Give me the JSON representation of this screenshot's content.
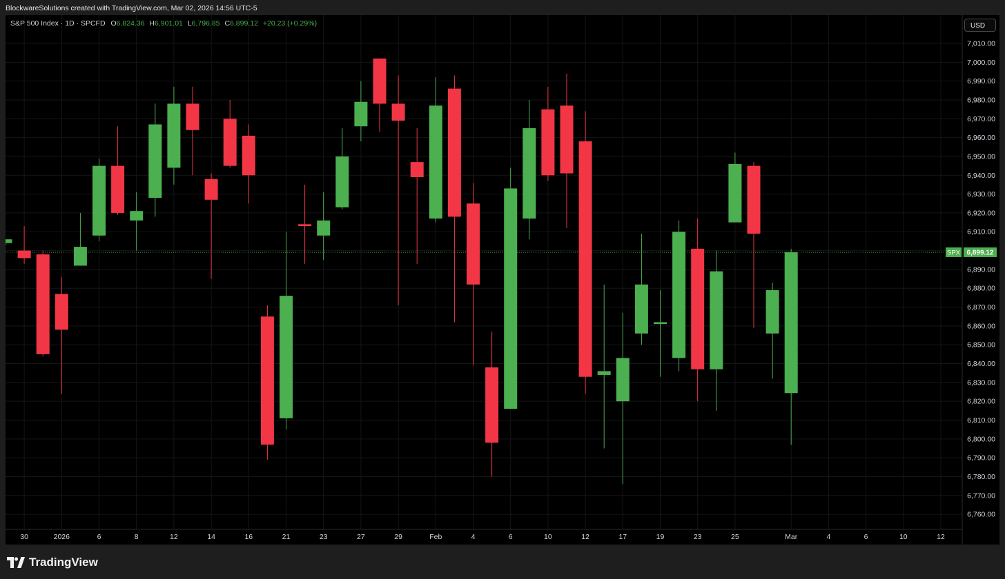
{
  "header": {
    "credit": "BlockwareSolutions created with TradingView.com, Mar 02, 2026 14:56 UTC-5"
  },
  "legend": {
    "symbol": "S&P 500 Index · 1D · SPCFD",
    "o_label": "O",
    "o_value": "6,824.36",
    "h_label": "H",
    "h_value": "6,901.01",
    "l_label": "L",
    "l_value": "6,796.85",
    "c_label": "C",
    "c_value": "6,899.12",
    "change": "+20.23 (+0.29%)"
  },
  "currency_button": "USD",
  "price_tag": {
    "symbol": "SPX",
    "value": "6,899.12"
  },
  "brand": "TradingView",
  "colors": {
    "up": "#4caf50",
    "down": "#f23645",
    "background": "#000000",
    "text": "#d1d4dc",
    "legend_value": "#4caf50"
  },
  "chart_data": {
    "type": "candlestick",
    "interval": "1D",
    "symbol": "SPX",
    "last_price": 6899.12,
    "ylim": [
      6752,
      7025
    ],
    "y_ticks": [
      {
        "v": 6760,
        "label": "6,760.00"
      },
      {
        "v": 6770,
        "label": "6,770.00"
      },
      {
        "v": 6780,
        "label": "6,780.00"
      },
      {
        "v": 6790,
        "label": "6,790.00"
      },
      {
        "v": 6800,
        "label": "6,800.00"
      },
      {
        "v": 6810,
        "label": "6,810.00"
      },
      {
        "v": 6820,
        "label": "6,820.00"
      },
      {
        "v": 6830,
        "label": "6,830.00"
      },
      {
        "v": 6840,
        "label": "6,840.00"
      },
      {
        "v": 6850,
        "label": "6,850.00"
      },
      {
        "v": 6860,
        "label": "6,860.00"
      },
      {
        "v": 6870,
        "label": "6,870.00"
      },
      {
        "v": 6880,
        "label": "6,880.00"
      },
      {
        "v": 6890,
        "label": "6,890.00"
      },
      {
        "v": 6900,
        "label": "6,900.00"
      },
      {
        "v": 6910,
        "label": "6,910.00"
      },
      {
        "v": 6920,
        "label": "6,920.00"
      },
      {
        "v": 6930,
        "label": "6,930.00"
      },
      {
        "v": 6940,
        "label": "6,940.00"
      },
      {
        "v": 6950,
        "label": "6,950.00"
      },
      {
        "v": 6960,
        "label": "6,960.00"
      },
      {
        "v": 6970,
        "label": "6,970.00"
      },
      {
        "v": 6980,
        "label": "6,980.00"
      },
      {
        "v": 6990,
        "label": "6,990.00"
      },
      {
        "v": 7000,
        "label": "7,000.00"
      },
      {
        "v": 7010,
        "label": "7,010.00"
      }
    ],
    "x_ticks": [
      {
        "i": 1,
        "label": "30"
      },
      {
        "i": 3,
        "label": "2026"
      },
      {
        "i": 5,
        "label": "6"
      },
      {
        "i": 7,
        "label": "8"
      },
      {
        "i": 9,
        "label": "12"
      },
      {
        "i": 11,
        "label": "14"
      },
      {
        "i": 13,
        "label": "16"
      },
      {
        "i": 15,
        "label": "21"
      },
      {
        "i": 17,
        "label": "23"
      },
      {
        "i": 19,
        "label": "27"
      },
      {
        "i": 21,
        "label": "29"
      },
      {
        "i": 23,
        "label": "Feb"
      },
      {
        "i": 25,
        "label": "4"
      },
      {
        "i": 27,
        "label": "6"
      },
      {
        "i": 29,
        "label": "10"
      },
      {
        "i": 31,
        "label": "12"
      },
      {
        "i": 33,
        "label": "17"
      },
      {
        "i": 35,
        "label": "19"
      },
      {
        "i": 37,
        "label": "23"
      },
      {
        "i": 39,
        "label": "25"
      },
      {
        "i": 42,
        "label": "Mar"
      },
      {
        "i": 44,
        "label": "4"
      },
      {
        "i": 46,
        "label": "6"
      },
      {
        "i": 48,
        "label": "10"
      },
      {
        "i": 50,
        "label": "12"
      }
    ],
    "candles": [
      {
        "i": 0,
        "o": 6904,
        "h": 6905,
        "l": 6903,
        "c": 6906
      },
      {
        "i": 1,
        "o": 6900,
        "h": 6913,
        "l": 6893,
        "c": 6896
      },
      {
        "i": 2,
        "o": 6898,
        "h": 6900,
        "l": 6844,
        "c": 6845
      },
      {
        "i": 3,
        "o": 6877,
        "h": 6886,
        "l": 6824,
        "c": 6858
      },
      {
        "i": 4,
        "o": 6892,
        "h": 6920,
        "l": 6892,
        "c": 6902
      },
      {
        "i": 5,
        "o": 6908,
        "h": 6949,
        "l": 6905,
        "c": 6945
      },
      {
        "i": 6,
        "o": 6945,
        "h": 6966,
        "l": 6919,
        "c": 6920
      },
      {
        "i": 7,
        "o": 6916,
        "h": 6931,
        "l": 6900,
        "c": 6921
      },
      {
        "i": 8,
        "o": 6928,
        "h": 6978,
        "l": 6918,
        "c": 6967
      },
      {
        "i": 9,
        "o": 6944,
        "h": 6987,
        "l": 6935,
        "c": 6978
      },
      {
        "i": 10,
        "o": 6978,
        "h": 6987,
        "l": 6940,
        "c": 6964
      },
      {
        "i": 11,
        "o": 6938,
        "h": 6941,
        "l": 6885,
        "c": 6927
      },
      {
        "i": 12,
        "o": 6970,
        "h": 6980,
        "l": 6944,
        "c": 6945
      },
      {
        "i": 13,
        "o": 6961,
        "h": 6967,
        "l": 6925,
        "c": 6940
      },
      {
        "i": 14,
        "o": 6865,
        "h": 6871,
        "l": 6789,
        "c": 6797
      },
      {
        "i": 15,
        "o": 6811,
        "h": 6910,
        "l": 6805,
        "c": 6876
      },
      {
        "i": 16,
        "o": 6914,
        "h": 6935,
        "l": 6893,
        "c": 6913
      },
      {
        "i": 17,
        "o": 6908,
        "h": 6931,
        "l": 6895,
        "c": 6916
      },
      {
        "i": 18,
        "o": 6923,
        "h": 6965,
        "l": 6922,
        "c": 6950
      },
      {
        "i": 19,
        "o": 6966,
        "h": 6990,
        "l": 6958,
        "c": 6979
      },
      {
        "i": 20,
        "o": 7002,
        "h": 7002,
        "l": 6963,
        "c": 6978
      },
      {
        "i": 21,
        "o": 6978,
        "h": 6993,
        "l": 6871,
        "c": 6969
      },
      {
        "i": 22,
        "o": 6947,
        "h": 6965,
        "l": 6893,
        "c": 6939
      },
      {
        "i": 23,
        "o": 6917,
        "h": 6992,
        "l": 6915,
        "c": 6977
      },
      {
        "i": 24,
        "o": 6986,
        "h": 6993,
        "l": 6862,
        "c": 6918
      },
      {
        "i": 25,
        "o": 6925,
        "h": 6936,
        "l": 6839,
        "c": 6882
      },
      {
        "i": 26,
        "o": 6838,
        "h": 6857,
        "l": 6780,
        "c": 6798
      },
      {
        "i": 27,
        "o": 6816,
        "h": 6944,
        "l": 6816,
        "c": 6933
      },
      {
        "i": 28,
        "o": 6917,
        "h": 6980,
        "l": 6906,
        "c": 6965
      },
      {
        "i": 29,
        "o": 6975,
        "h": 6987,
        "l": 6937,
        "c": 6940
      },
      {
        "i": 30,
        "o": 6977,
        "h": 6994,
        "l": 6912,
        "c": 6941
      },
      {
        "i": 31,
        "o": 6958,
        "h": 6974,
        "l": 6824,
        "c": 6833
      },
      {
        "i": 32,
        "o": 6834,
        "h": 6882,
        "l": 6795,
        "c": 6836
      },
      {
        "i": 33,
        "o": 6820,
        "h": 6867,
        "l": 6776,
        "c": 6843
      },
      {
        "i": 34,
        "o": 6856,
        "h": 6909,
        "l": 6850,
        "c": 6882
      },
      {
        "i": 35,
        "o": 6861,
        "h": 6879,
        "l": 6833,
        "c": 6862
      },
      {
        "i": 36,
        "o": 6843,
        "h": 6916,
        "l": 6836,
        "c": 6910
      },
      {
        "i": 37,
        "o": 6901,
        "h": 6917,
        "l": 6820,
        "c": 6837
      },
      {
        "i": 38,
        "o": 6837,
        "h": 6900,
        "l": 6815,
        "c": 6889
      },
      {
        "i": 39,
        "o": 6915,
        "h": 6952,
        "l": 6915,
        "c": 6946
      },
      {
        "i": 40,
        "o": 6945,
        "h": 6947,
        "l": 6859,
        "c": 6909
      },
      {
        "i": 41,
        "o": 6856,
        "h": 6883,
        "l": 6832,
        "c": 6879
      },
      {
        "i": 42,
        "o": 6824.36,
        "h": 6901.01,
        "l": 6796.85,
        "c": 6899.12
      }
    ]
  }
}
